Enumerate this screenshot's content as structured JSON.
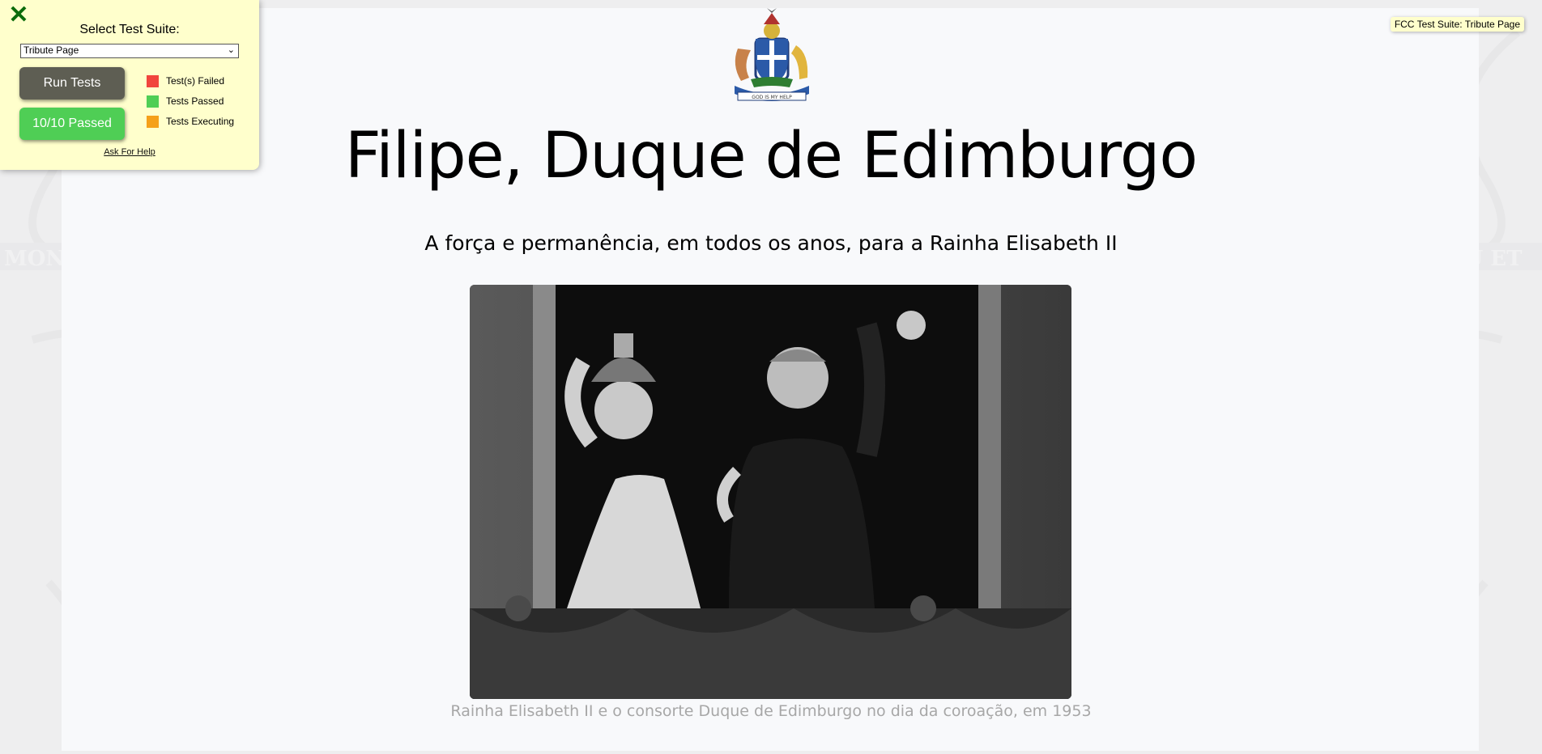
{
  "page": {
    "title": "Filipe, Duque de Edimburgo",
    "subtitle": "A força e permanência, em todos os anos, para a Rainha Elisabeth II",
    "caption": "Rainha Elisabeth II e o consorte Duque de Edimburgo no dia da coroação, em 1953",
    "crest_icon": "coat-of-arms",
    "crest_motto": "GOD IS MY HELP",
    "photo_icon": "coronation-balcony-photo",
    "background_motto_left": "MON DROIT",
    "background_motto_right": "DIEU ET"
  },
  "fcc": {
    "close_icon": "close-x",
    "select_label": "Select Test Suite:",
    "selected_suite": "Tribute Page",
    "run_button": "Run Tests",
    "result_button": "10/10 Passed",
    "legend": [
      {
        "label": "Test(s) Failed",
        "color": "#f1453d"
      },
      {
        "label": "Tests Passed",
        "color": "#4fce55"
      },
      {
        "label": "Tests Executing",
        "color": "#f5a01a"
      }
    ],
    "help_link": "Ask For Help",
    "tag": "FCC Test Suite: Tribute Page"
  },
  "colors": {
    "panel_bg": "#ffffcc",
    "run_button_bg": "#5e5e53",
    "passed_button_bg": "#4fce55",
    "close_icon": "#0b6b0b",
    "caption_text": "#a7a7a7"
  }
}
